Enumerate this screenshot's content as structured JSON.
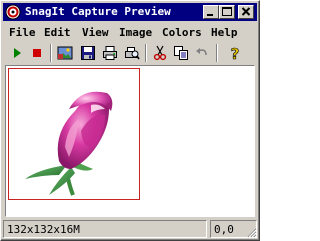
{
  "window": {
    "title": "SnagIt Capture Preview",
    "icon": "snagit-app-icon",
    "controls": [
      "minimize-icon",
      "maximize-icon",
      "close-icon"
    ]
  },
  "menu": {
    "items": [
      {
        "label": "File"
      },
      {
        "label": "Edit"
      },
      {
        "label": "View"
      },
      {
        "label": "Image"
      },
      {
        "label": "Colors"
      },
      {
        "label": "Help"
      }
    ]
  },
  "toolbar": {
    "buttons": [
      {
        "icon": "play-icon",
        "color": "#008000"
      },
      {
        "icon": "stop-icon",
        "color": "#d00000"
      },
      {
        "icon": "image-properties-icon"
      },
      {
        "icon": "save-icon"
      },
      {
        "icon": "print-icon"
      },
      {
        "icon": "print-preview-icon"
      },
      {
        "icon": "cut-icon"
      },
      {
        "icon": "copy-icon"
      },
      {
        "icon": "undo-icon"
      },
      {
        "icon": "help-icon"
      }
    ]
  },
  "preview": {
    "image": "pink-rose-icon",
    "border_color": "#cc2222"
  },
  "status": {
    "image_info": "132x132x16M",
    "coordinates": "0,0"
  }
}
